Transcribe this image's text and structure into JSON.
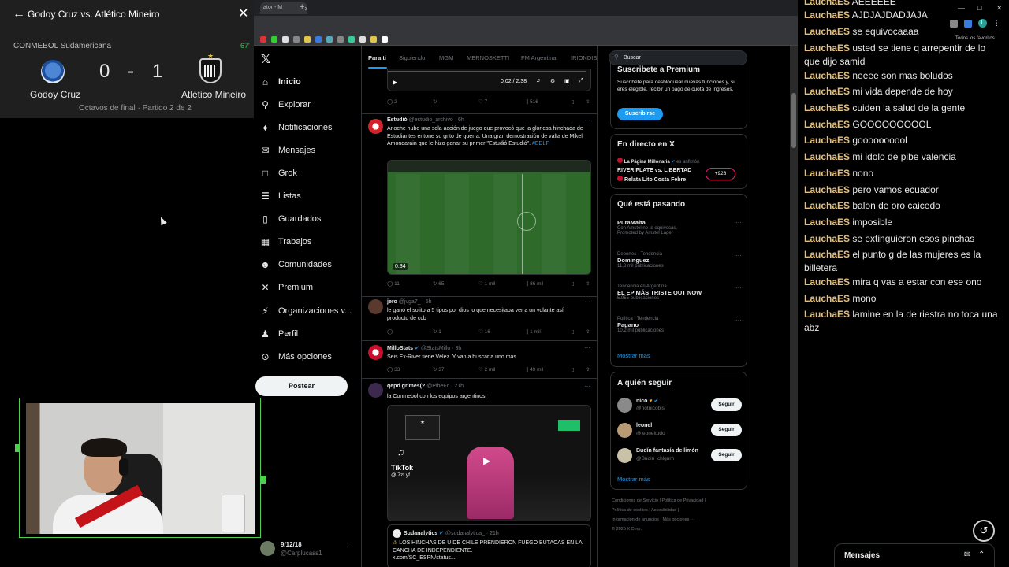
{
  "match_panel": {
    "title": "Godoy Cruz vs. Atlético Mineiro",
    "competition": "CONMEBOL Sudamericana",
    "minute": "67'",
    "home_team": "Godoy Cruz",
    "away_team": "Atlético Mineiro",
    "home_score": "0",
    "score_separator": "-",
    "away_score": "1",
    "round": "Octavos de final · Partido 2 de 2"
  },
  "browser": {
    "tab_title": "ator - M",
    "bookmarks_folder": "Todos los favoritos",
    "profile_initial": "L"
  },
  "x_nav": {
    "items": [
      {
        "label": "Inicio",
        "icon": "home-icon"
      },
      {
        "label": "Explorar",
        "icon": "search-icon"
      },
      {
        "label": "Notificaciones",
        "icon": "bell-icon"
      },
      {
        "label": "Mensajes",
        "icon": "envelope-icon"
      },
      {
        "label": "Grok",
        "icon": "grok-icon"
      },
      {
        "label": "Listas",
        "icon": "list-icon"
      },
      {
        "label": "Guardados",
        "icon": "bookmark-icon"
      },
      {
        "label": "Trabajos",
        "icon": "briefcase-icon"
      },
      {
        "label": "Comunidades",
        "icon": "people-icon"
      },
      {
        "label": "Premium",
        "icon": "x-icon"
      },
      {
        "label": "Organizaciones v...",
        "icon": "lightning-icon"
      },
      {
        "label": "Perfil",
        "icon": "person-icon"
      },
      {
        "label": "Más opciones",
        "icon": "more-circle-icon"
      }
    ],
    "post_button": "Postear",
    "profile_name": "9/12/18",
    "profile_handle": "@Carplucass1"
  },
  "timeline": {
    "tabs": [
      "Para ti",
      "Siguiendo",
      "MGM",
      "MERNOSKETTI",
      "FM Argentina",
      "IRIONDIS"
    ],
    "top_video": {
      "time": "0:02 / 2:38",
      "replies": "2",
      "reposts": "",
      "likes": "7",
      "views": "516"
    },
    "posts": [
      {
        "name": "Estudió",
        "handle": "@estudio_archivo · 6h",
        "text": "Anoche hubo una sola acción de juego que provocó que la gloriosa hinchada de Estudiantes entone su grito de guerra: Una gran demostración de valía de Mikel Amondarain que le hizo ganar su primer \"Estudió Estudió\".",
        "hashtag": "#EDLP",
        "video_time": "0:34",
        "replies": "11",
        "reposts": "65",
        "likes": "1 mil",
        "views": "86 mil"
      },
      {
        "name": "jero",
        "handle": "@jvga7_ · 5h",
        "text": "le ganó el solito a 5 tipos por dios lo que necesitaba ver a un volante así producto de ccb",
        "replies": "",
        "reposts": "1",
        "likes": "16",
        "views": "1 mil"
      },
      {
        "name": "MilloStats",
        "handle": "@StatsMillo · 3h",
        "text": "Seis Ex-River tiene Vélez. Y van a buscar a uno más",
        "replies": "33",
        "reposts": "37",
        "likes": "2 mil",
        "views": "49 mil"
      },
      {
        "name": "qepd grimes(?",
        "handle": "@PibeFc · 21h",
        "text": "la Conmebol con los equipos argentinos:",
        "tiktok_label": "TikTok",
        "tiktok_user": "@ 7zf.yf",
        "quote_name": "Sudanalytics",
        "quote_handle": "@sudanalytica_ · 21h",
        "quote_text": "LOS HINCHAS DE U DE CHILE PRENDIERON FUEGO BUTACAS EN LA CANCHA DE INDEPENDIENTE.",
        "quote_link": "x.com/SC_ESPN/status..."
      }
    ]
  },
  "sidebar": {
    "search_placeholder": "Buscar",
    "premium_title": "Suscribete a Premium",
    "premium_text": "Suscríbete para desbloquear nuevas funciones y, si eres elegible, recibir un pago de cuota de ingresos.",
    "premium_button": "Suscribirse",
    "live_title": "En directo en X",
    "live_host": "La Página Millonaria",
    "live_host_role": "es anfitrión",
    "live_text": "RIVER PLATE vs. LIBERTAD",
    "live_text2": "Relata Lito Costa Febre",
    "live_count": "+928",
    "trends_title": "Qué está pasando",
    "trends": [
      {
        "category": "",
        "name": "PuraMalta",
        "posts": "Con Amstel no te equivocás.",
        "extra": "Promoted by Amstel Lager"
      },
      {
        "category": "Deportes · Tendencia",
        "name": "Domínguez",
        "posts": "11,3 mil publicaciones"
      },
      {
        "category": "Tendencia en Argentina",
        "name": "EL EP MÁS TRISTE OUT NOW",
        "posts": "5.955 publicaciones"
      },
      {
        "category": "Política · Tendencia",
        "name": "Pagano",
        "posts": "10,2 mil publicaciones"
      }
    ],
    "show_more": "Mostrar más",
    "follow_title": "A quién seguir",
    "follow": [
      {
        "name": "nico",
        "handle": "@notnicobjs"
      },
      {
        "name": "leonel",
        "handle": "@leoneltudo"
      },
      {
        "name": "Budín fantasía de limón",
        "handle": "@Budin_chlgurh"
      }
    ],
    "follow_button": "Seguir",
    "footer": [
      "Condiciones de Servicio",
      "Política de Privacidad",
      "Política de cookies",
      "Accesibilidad",
      "Información de anuncios",
      "Más opciones ···",
      "© 2025 X Corp."
    ]
  },
  "messages_dock": {
    "label": "Mensajes"
  },
  "chat": {
    "top_partial": {
      "user": "LauchaES",
      "text": "AEEEEEE"
    },
    "lines": [
      {
        "user": "LauchaES",
        "text": "AJDJAJDADJAJA"
      },
      {
        "user": "LauchaES",
        "text": "se equivocaaaa"
      },
      {
        "user": "LauchaES",
        "text": "usted se tiene q arrepentir de lo que dijo samid"
      },
      {
        "user": "LauchaES",
        "text": "neeee son mas boludos"
      },
      {
        "user": "LauchaES",
        "text": "mi vida depende de hoy"
      },
      {
        "user": "LauchaES",
        "text": "cuiden la salud de la gente"
      },
      {
        "user": "LauchaES",
        "text": "GOOOOOOOOOL"
      },
      {
        "user": "LauchaES",
        "text": "goooooooool"
      },
      {
        "user": "LauchaES",
        "text": "mi idolo de pibe valencia"
      },
      {
        "user": "LauchaES",
        "text": "nono"
      },
      {
        "user": "LauchaES",
        "text": "pero vamos ecuador"
      },
      {
        "user": "LauchaES",
        "text": "balon de oro caicedo"
      },
      {
        "user": "LauchaES",
        "text": "imposible"
      },
      {
        "user": "LauchaES",
        "text": "se extinguieron esos pinchas"
      },
      {
        "user": "LauchaES",
        "text": "el punto g de las mujeres es la billetera"
      },
      {
        "user": "LauchaES",
        "text": "mira q vas a estar con ese ono"
      },
      {
        "user": "LauchaES",
        "text": "mono"
      },
      {
        "user": "LauchaES",
        "text": "lamine en la de riestra no toca una abz"
      }
    ]
  },
  "colors": {
    "username": "#e5c07b",
    "x_blue": "#1d9bf0",
    "webcam_border": "#4bd14b"
  }
}
